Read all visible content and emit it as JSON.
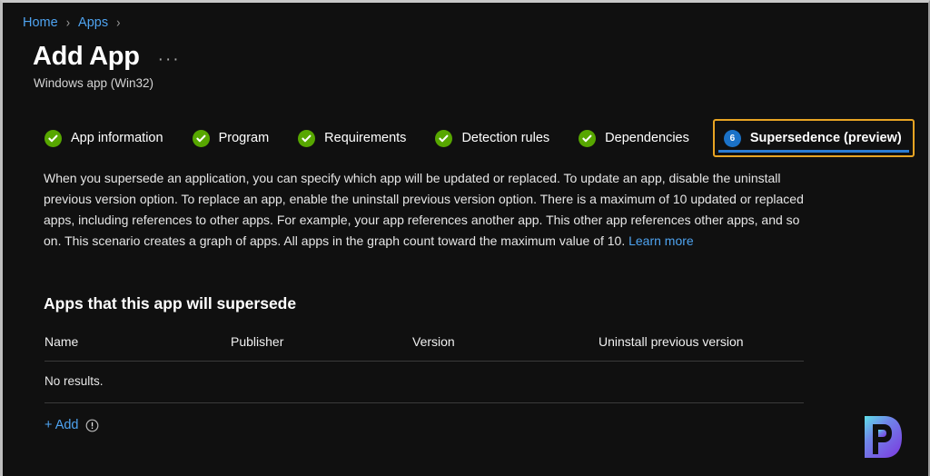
{
  "window": {
    "background_color": "#101010",
    "border_color": "#c8c8c8"
  },
  "breadcrumb": {
    "items": [
      {
        "label": "Home"
      },
      {
        "label": "Apps"
      }
    ],
    "separator": "›"
  },
  "header": {
    "title": "Add App",
    "subtitle": "Windows app (Win32)",
    "more_menu": "···"
  },
  "tabs": {
    "items": [
      {
        "label": "App information",
        "state": "complete",
        "icon": "check-circle-icon",
        "badge": ""
      },
      {
        "label": "Program",
        "state": "complete",
        "icon": "check-circle-icon",
        "badge": ""
      },
      {
        "label": "Requirements",
        "state": "complete",
        "icon": "check-circle-icon",
        "badge": ""
      },
      {
        "label": "Detection rules",
        "state": "complete",
        "icon": "check-circle-icon",
        "badge": ""
      },
      {
        "label": "Dependencies",
        "state": "complete",
        "icon": "check-circle-icon",
        "badge": ""
      },
      {
        "label": "Supersedence (preview)",
        "state": "active",
        "icon": "number-badge-icon",
        "badge": "6"
      }
    ],
    "complete_color": "#57a700",
    "active_badge_color": "#1b72c8",
    "focus_outline_color": "#e8a423",
    "underline_color": "#2b7cd3"
  },
  "main": {
    "description": "When you supersede an application, you can specify which app will be updated or replaced. To update an app, disable the uninstall previous version option. To replace an app, enable the uninstall previous version option. There is a maximum of 10 updated or replaced apps, including references to other apps. For example, your app references another app. This other app references other apps, and so on. This scenario creates a graph of apps. All apps in the graph count toward the maximum value of 10. ",
    "learn_more": "Learn more",
    "section_title": "Apps that this app will supersede",
    "table": {
      "columns": [
        "Name",
        "Publisher",
        "Version",
        "Uninstall previous version"
      ],
      "rows": [],
      "empty_message": "No results."
    },
    "add_link": "+ Add",
    "add_info_icon": "info-circle-icon"
  },
  "branding": {
    "logo_letter": "P",
    "logo_gradient_start": "#56d6e0",
    "logo_gradient_end": "#7a4ce0"
  }
}
